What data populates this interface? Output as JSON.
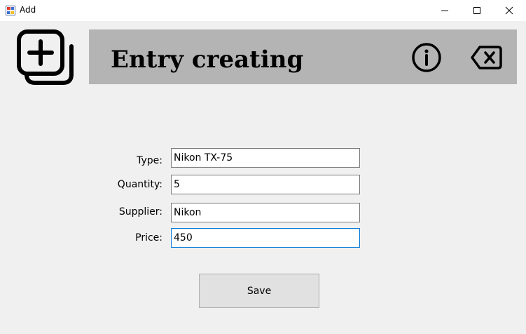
{
  "window": {
    "title": "Add"
  },
  "header": {
    "title": "Entry creating",
    "background": "#b4b4b4"
  },
  "icons": {
    "app": "app-window-icon",
    "logo": "add-copy-icon",
    "info": "info-icon",
    "clear": "backspace-clear-icon"
  },
  "form": {
    "type_label": "Type:",
    "type_value": "Nikon TX-75",
    "quantity_label": "Quantity:",
    "quantity_value": "5",
    "supplier_label": "Supplier:",
    "supplier_value": "Nikon",
    "price_label": "Price:",
    "price_value": "450"
  },
  "save_label": "Save",
  "colors": {
    "background": "#f0f0f0",
    "focus_border": "#0078d7"
  }
}
